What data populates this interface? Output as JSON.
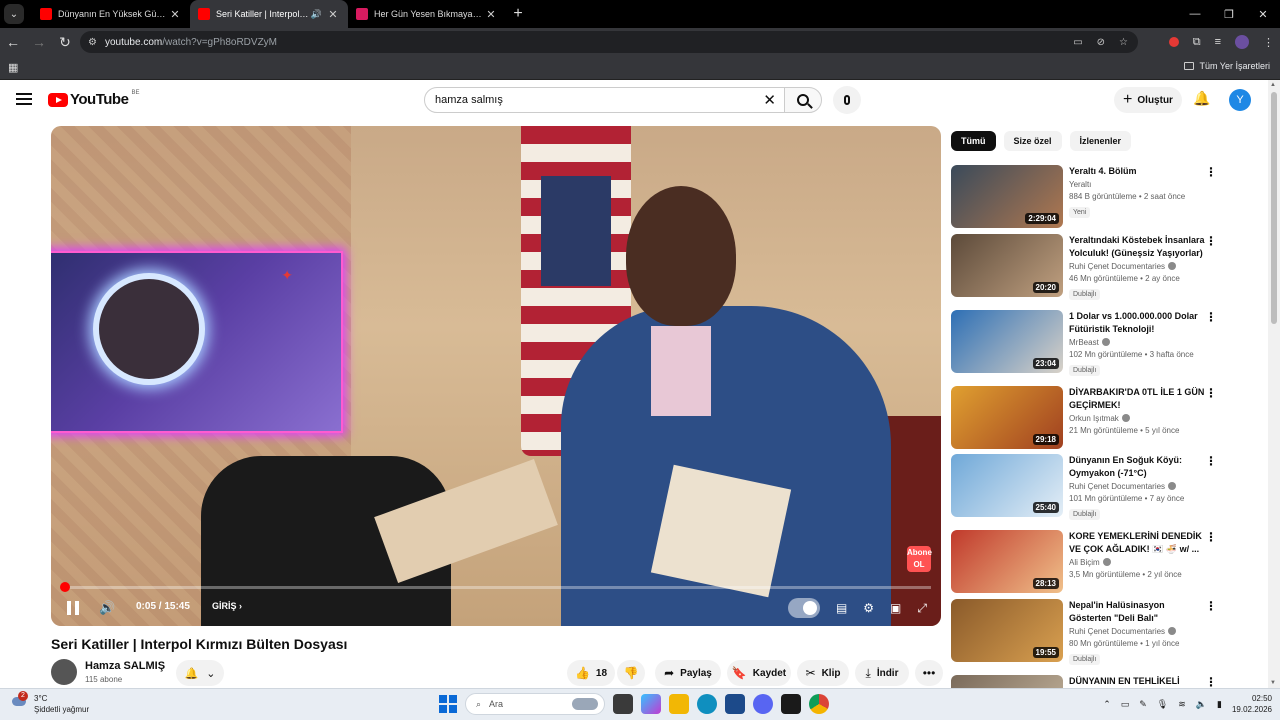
{
  "browser": {
    "tabs": [
      {
        "title": "Dünyanın En Yüksek Güvenlikli ...",
        "favicon_color": "#ff0000",
        "active": false
      },
      {
        "title": "Seri Katiller | Interpol Kırmızı ...",
        "favicon_color": "#ff0000",
        "active": true
      },
      {
        "title": "Her Gün Yesen Bıkmayacağın Ye...",
        "favicon_color": "#d81b60",
        "active": false
      }
    ],
    "url_domain": "youtube.com",
    "url_path": "/watch?v=gPh8oRDVZyM",
    "bookmarks_all_label": "Tüm Yer İşaretleri"
  },
  "header": {
    "logo_text": "YouTube",
    "country_code": "BE",
    "search_value": "hamza salmış",
    "create_label": "Oluştur",
    "avatar_letter": "Y"
  },
  "player": {
    "current_time": "0:05",
    "duration": "15:45",
    "time_display": "0:05 / 15:45",
    "progress_fraction": 0.005,
    "chapter_label": "GİRİŞ",
    "badge_line1": "Abone",
    "badge_line2": "OL"
  },
  "video": {
    "title": "Seri Katiller | Interpol Kırmızı Bülten Dosyası",
    "channel_name": "Hamza SALMIŞ",
    "subscribers": "115 abone",
    "like_count": "18",
    "share_label": "Paylaş",
    "save_label": "Kaydet",
    "clip_label": "Klip",
    "download_label": "İndir"
  },
  "sidebar": {
    "chips": [
      "Tümü",
      "Size özel",
      "İzlenenler"
    ],
    "items": [
      {
        "title": "Yeraltı 4. Bölüm",
        "channel": "Yeraltı",
        "stats": "884 B görüntüleme • 2 saat önce",
        "badge": "Yeni",
        "duration": "2:29:04",
        "color1": "#3a4a5a",
        "color2": "#b07850"
      },
      {
        "title": "Yeraltındaki Köstebek İnsanlara Yolculuk! (Güneşsiz Yaşıyorlar)",
        "channel": "Ruhi Çenet Documentaries",
        "stats": "46 Mn görüntüleme • 2 ay önce",
        "badge": "Dublajlı",
        "duration": "20:20",
        "color1": "#5c4a3a",
        "color2": "#c0a080"
      },
      {
        "title": "1 Dolar vs 1.000.000.000 Dolar Fütüristik Teknoloji!",
        "channel": "MrBeast",
        "stats": "102 Mn görüntüleme • 3 hafta önce",
        "badge": "Dublajlı",
        "duration": "23:04",
        "color1": "#2d6fb5",
        "color2": "#d9d2c8"
      },
      {
        "title": "DİYARBAKIR'DA 0TL İLE 1 GÜN GEÇİRMEK!",
        "channel": "Orkun Işıtmak",
        "stats": "21 Mn görüntüleme • 5 yıl önce",
        "badge": "",
        "duration": "29:18",
        "color1": "#e0a030",
        "color2": "#a04020"
      },
      {
        "title": "Dünyanın En Soğuk Köyü: Oymyakon (-71°C)",
        "channel": "Ruhi Çenet Documentaries",
        "stats": "101 Mn görüntüleme • 7 ay önce",
        "badge": "Dublajlı",
        "duration": "25:40",
        "color1": "#6fa8d8",
        "color2": "#e4eef6"
      },
      {
        "title": "KORE YEMEKLERİNİ DENEDİK VE ÇOK AĞLADIK! 🇰🇷 🍜 w/ ...",
        "channel": "Ali Biçim",
        "stats": "3,5 Mn görüntüleme • 2 yıl önce",
        "badge": "",
        "duration": "28:13",
        "color1": "#c0392b",
        "color2": "#f0c08a"
      },
      {
        "title": "Nepal'in Halüsinasyon Gösterten \"Deli Balı\" (Delirmek...",
        "channel": "Ruhi Çenet Documentaries",
        "stats": "80 Mn görüntüleme • 1 yıl önce",
        "badge": "Dublajlı",
        "duration": "19:55",
        "color1": "#8a5a2a",
        "color2": "#d9a050"
      },
      {
        "title": "DÜNYANIN EN TEHLİKELİ",
        "channel": "",
        "stats": "",
        "badge": "",
        "duration": "",
        "color1": "#7a6a5a",
        "color2": "#c8b8a0"
      }
    ]
  },
  "taskbar": {
    "weather_temp": "3°C",
    "weather_desc": "Şiddetli yağmur",
    "weather_notif": "2",
    "search_label": "Ara",
    "time": "02:50",
    "date": "19.02.2026"
  }
}
